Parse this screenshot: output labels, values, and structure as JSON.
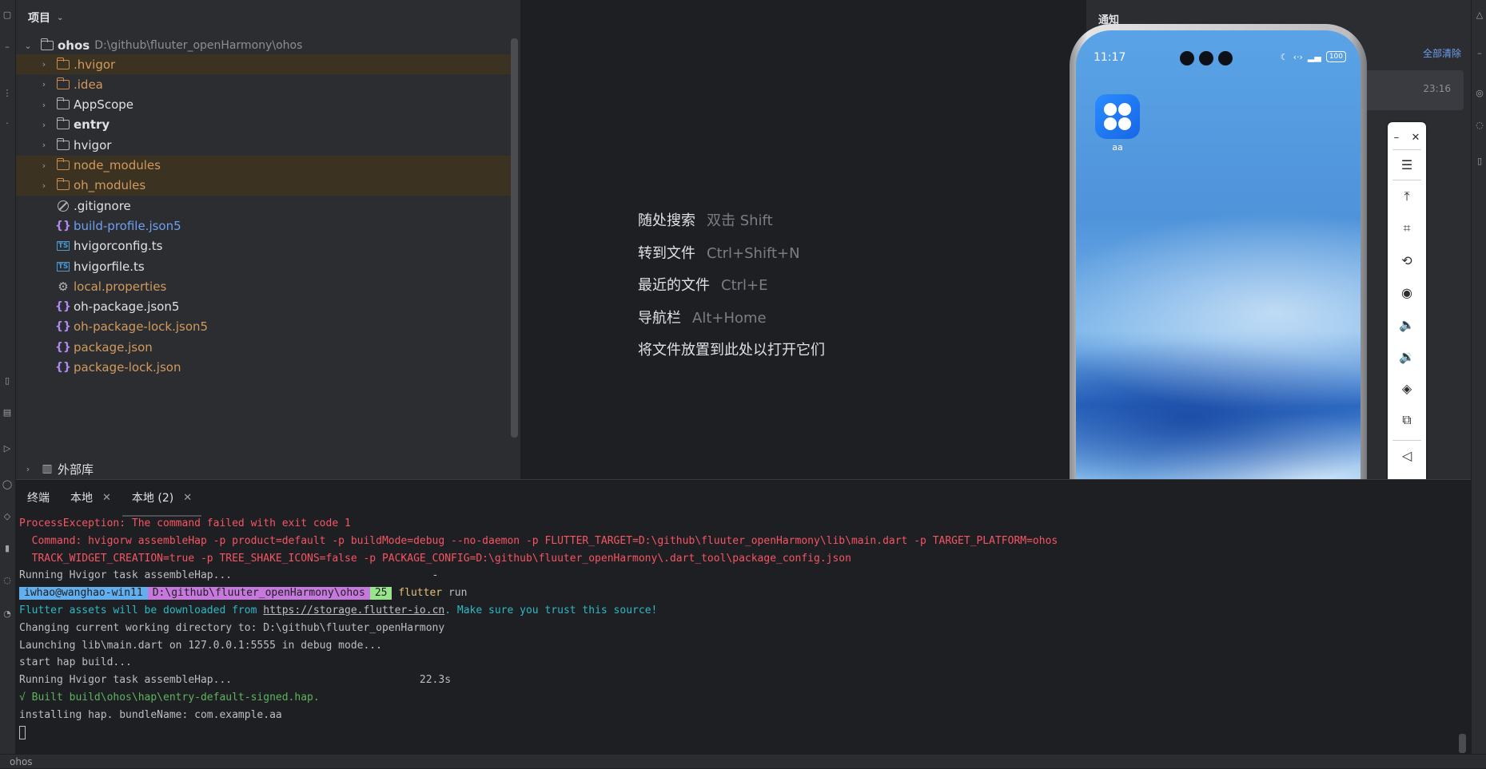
{
  "project": {
    "header_label": "项目",
    "root": {
      "name": "ohos",
      "path": "D:\\github\\fluuter_openHarmony\\ohos"
    },
    "items": [
      {
        "label": ".hvigor",
        "kind": "folder",
        "style": "orange",
        "highlight": true,
        "expandable": true
      },
      {
        "label": ".idea",
        "kind": "folder",
        "style": "orange",
        "highlight": false,
        "expandable": true
      },
      {
        "label": "AppScope",
        "kind": "folder",
        "style": "white",
        "highlight": false,
        "expandable": true
      },
      {
        "label": "entry",
        "kind": "module",
        "style": "bold",
        "highlight": false,
        "expandable": true
      },
      {
        "label": "hvigor",
        "kind": "folder",
        "style": "white",
        "highlight": false,
        "expandable": true
      },
      {
        "label": "node_modules",
        "kind": "folder",
        "style": "orange",
        "highlight": true,
        "expandable": true
      },
      {
        "label": "oh_modules",
        "kind": "folder",
        "style": "orange",
        "highlight": true,
        "expandable": true
      },
      {
        "label": ".gitignore",
        "kind": "ignore",
        "style": "white",
        "highlight": false,
        "expandable": false
      },
      {
        "label": "build-profile.json5",
        "kind": "json",
        "style": "blue",
        "highlight": false,
        "expandable": false
      },
      {
        "label": "hvigorconfig.ts",
        "kind": "ts",
        "style": "white",
        "highlight": false,
        "expandable": false
      },
      {
        "label": "hvigorfile.ts",
        "kind": "ts",
        "style": "white",
        "highlight": false,
        "expandable": false
      },
      {
        "label": "local.properties",
        "kind": "gear",
        "style": "orange",
        "highlight": false,
        "expandable": false
      },
      {
        "label": "oh-package.json5",
        "kind": "json",
        "style": "white",
        "highlight": false,
        "expandable": false
      },
      {
        "label": "oh-package-lock.json5",
        "kind": "json",
        "style": "orange",
        "highlight": false,
        "expandable": false
      },
      {
        "label": "package.json",
        "kind": "json",
        "style": "orange",
        "highlight": false,
        "expandable": false
      },
      {
        "label": "package-lock.json",
        "kind": "json",
        "style": "orange",
        "highlight": false,
        "expandable": false
      }
    ],
    "external_libs": "外部库"
  },
  "editor_hints": [
    {
      "action": "随处搜索",
      "key": "双击 Shift"
    },
    {
      "action": "转到文件",
      "key": "Ctrl+Shift+N"
    },
    {
      "action": "最近的文件",
      "key": "Ctrl+E"
    },
    {
      "action": "导航栏",
      "key": "Alt+Home"
    },
    {
      "action": "将文件放置到此处以打开它们",
      "key": ""
    }
  ],
  "notifications": {
    "title": "通知",
    "clear_all": "全部清除",
    "time": "23:16"
  },
  "terminal": {
    "tabs": [
      {
        "label": "终端",
        "closable": false,
        "active": false
      },
      {
        "label": "本地",
        "closable": true,
        "active": false
      },
      {
        "label": "本地 (2)",
        "closable": true,
        "active": true
      }
    ],
    "lines": {
      "l1": "ProcessException: The command failed with exit code 1",
      "l2": "  Command: hvigorw assembleHap -p product=default -p buildMode=debug --no-daemon -p FLUTTER_TARGET=D:\\github\\fluuter_openHarmony\\lib\\main.dart -p TARGET_PLATFORM=ohos",
      "l3": "  TRACK_WIDGET_CREATION=true -p TREE_SHAKE_ICONS=false -p PACKAGE_CONFIG=D:\\github\\fluuter_openHarmony\\.dart_tool\\package_config.json",
      "l4": "Running Hvigor task assembleHap...                                -",
      "prompt_user": "iwhao@wanghao-win11",
      "prompt_path": "D:\\github\\fluuter_openHarmony\\ohos",
      "prompt_num": "25",
      "prompt_cmd": "flutter",
      "prompt_arg": "run",
      "l6_pre": "Flutter assets will be downloaded from ",
      "l6_link": "https://storage.flutter-io.cn",
      "l6_post": ". Make sure you trust this source!",
      "l7": "Changing current working directory to: D:\\github\\fluuter_openHarmony",
      "l8": "Launching lib\\main.dart on 127.0.0.1:5555 in debug mode...",
      "l9": "start hap build...",
      "l10": "Running Hvigor task assembleHap...                              22.3s",
      "l11": "√ Built build\\ohos\\hap\\entry-default-signed.hap.",
      "l12": "installing hap. bundleName: com.example.aa"
    }
  },
  "status_bar": {
    "text": "ohos"
  },
  "phone": {
    "time": "11:17",
    "battery": "100",
    "app_label": "aa",
    "page_count": 3,
    "active_page": 3
  },
  "colors": {
    "accent": "#6f9ff1",
    "error": "#f75464",
    "success": "#5fb35f",
    "folder_orange": "#d29a5e"
  }
}
